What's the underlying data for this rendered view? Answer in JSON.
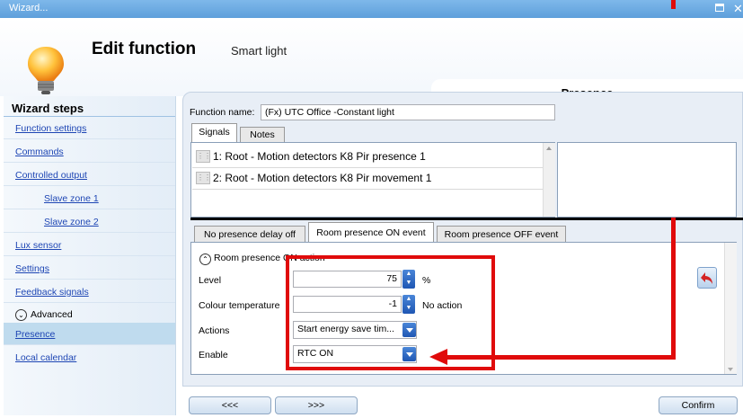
{
  "window": {
    "title": "Wizard..."
  },
  "header": {
    "title": "Edit function",
    "subtitle": "Smart light",
    "page_tab": "Presence"
  },
  "sidebar": {
    "heading": "Wizard steps",
    "items": [
      {
        "label": "Function settings"
      },
      {
        "label": "Commands"
      },
      {
        "label": "Controlled output"
      },
      {
        "label": "Slave zone 1"
      },
      {
        "label": "Slave zone 2"
      },
      {
        "label": "Lux sensor"
      },
      {
        "label": "Settings"
      },
      {
        "label": "Feedback signals"
      },
      {
        "label": "Advanced"
      },
      {
        "label": "Presence"
      },
      {
        "label": "Local calendar"
      }
    ]
  },
  "function": {
    "name_label": "Function name:",
    "name_value": "(Fx) UTC Office -Constant light"
  },
  "top_tabs": {
    "signals": "Signals",
    "notes": "Notes"
  },
  "signals": [
    {
      "text": "1: Root - Motion detectors K8 Pir presence 1"
    },
    {
      "text": "2: Root - Motion detectors K8 Pir movement 1"
    }
  ],
  "event_tabs": {
    "delay_off": "No presence delay off",
    "on_event": "Room presence ON event",
    "off_event": "Room presence OFF event"
  },
  "on_action": {
    "section_title": "Room presence ON action",
    "level_label": "Level",
    "level_value": "75",
    "level_unit": "%",
    "colour_label": "Colour temperature",
    "colour_value": "-1",
    "colour_unit": "No action",
    "actions_label": "Actions",
    "actions_value": "Start energy save tim...",
    "enable_label": "Enable",
    "enable_value": "RTC ON"
  },
  "footer": {
    "prev": "<<<",
    "next": ">>>",
    "confirm": "Confirm"
  },
  "colors": {
    "titlebar": "#6ba9e2",
    "link": "#1e46b4",
    "highlight": "#e00b0b",
    "accent_button": "#1f56b3"
  }
}
